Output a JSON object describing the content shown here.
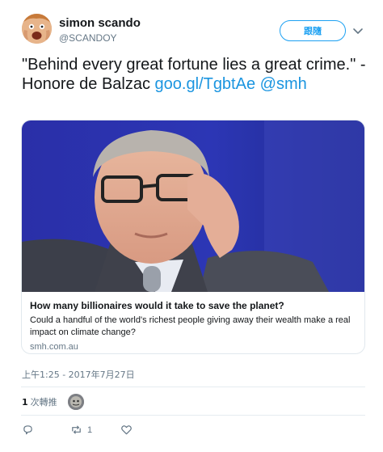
{
  "user": {
    "display_name": "simon scando",
    "handle": "@SCANDOY",
    "avatar_icon": "user-avatar",
    "follow_label": "跟隨"
  },
  "tweet": {
    "text": "\"Behind every great fortune lies a great crime.\" - Honore de Balzac",
    "link_text": "goo.gl/TgbtAe",
    "mention": "@smh"
  },
  "card": {
    "title": "How many billionaires would it take to save the planet?",
    "description": "Could a handful of the world's richest people giving away their wealth make a real impact on climate change?",
    "domain": "smh.com.au"
  },
  "meta": {
    "timestamp": "上午1:25 - 2017年7月27日"
  },
  "stats": {
    "retweet_count": "1",
    "retweet_label": "次轉推"
  },
  "actions": {
    "reply_count": "",
    "retweet_count": "1",
    "like_count": ""
  },
  "colors": {
    "accent": "#1da1f2",
    "link": "#1b95e0",
    "muted": "#657786"
  }
}
